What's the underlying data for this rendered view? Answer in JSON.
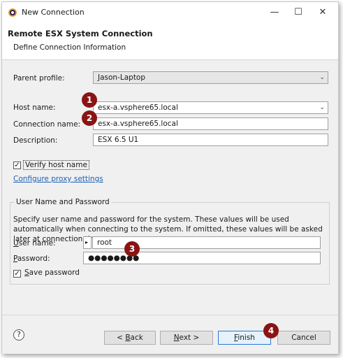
{
  "window": {
    "title": "New Connection",
    "controls": {
      "minimize": "—",
      "maximize": "☐",
      "close": "✕"
    }
  },
  "banner": {
    "title": "Remote ESX System Connection",
    "subtitle": "Define Connection Information"
  },
  "form": {
    "parent_profile": {
      "label": "Parent profile:",
      "value": "Jason-Laptop"
    },
    "host_name": {
      "label": "Host name:",
      "value": "esx-a.vsphere65.local"
    },
    "connection_name": {
      "label": "Connection name:",
      "value": "esx-a.vsphere65.local"
    },
    "description": {
      "label": "Description:",
      "value": "ESX 6.5 U1"
    },
    "verify_host": {
      "label": "Verify host name",
      "checked": true,
      "check_glyph": "✓"
    },
    "proxy_link": "Configure proxy settings"
  },
  "credentials": {
    "group_title": "User Name and Password",
    "description": "Specify user name and password for the system. These values will be used automatically when connecting to the system. If omitted, these values will be asked later at connection time.",
    "user": {
      "label": "User name:",
      "value": "root",
      "indicator": "▸"
    },
    "password": {
      "label": "Password:",
      "value": "●●●●●●●●"
    },
    "save_password": {
      "label": "Save password",
      "checked": true,
      "check_glyph": "✓"
    }
  },
  "markers": [
    "1",
    "2",
    "3",
    "4"
  ],
  "footer": {
    "help": "?",
    "back": "< Back",
    "next": "Next >",
    "finish": "Finish",
    "cancel": "Cancel"
  },
  "colors": {
    "marker": "#8a1414",
    "link": "#1a5fb4",
    "default_button_border": "#2b78d6"
  }
}
